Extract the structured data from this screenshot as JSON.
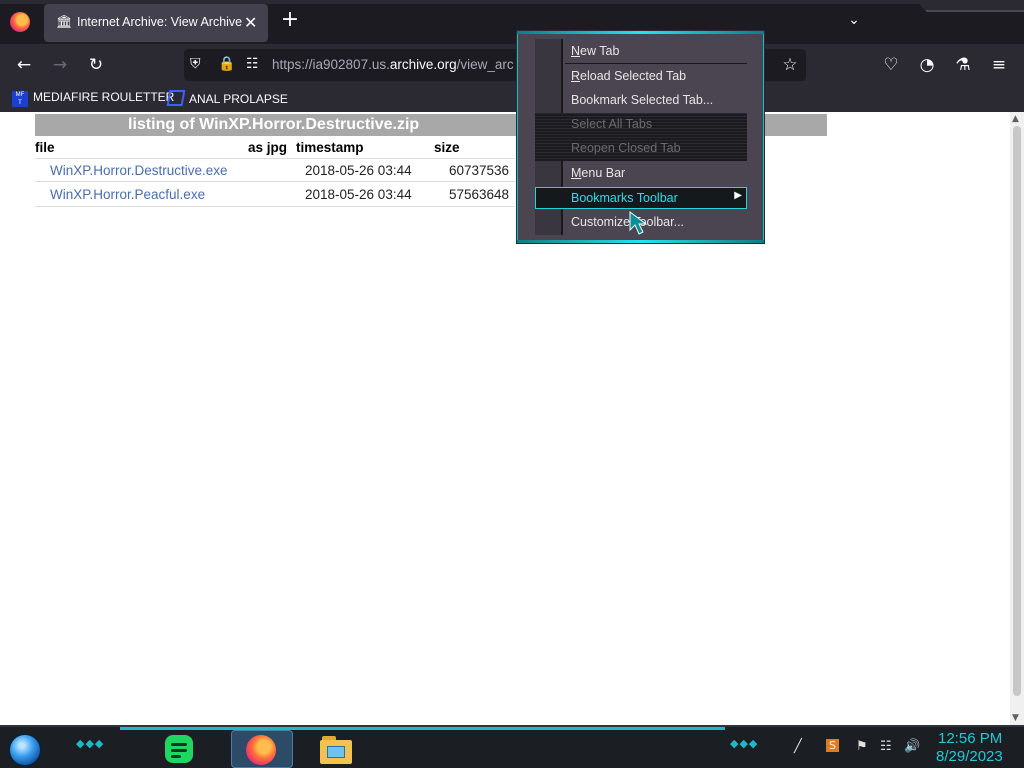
{
  "browser": {
    "tab": {
      "title": "Internet Archive: View Archive",
      "icon": "archive-columns-icon"
    },
    "new_tab_symbol": "+",
    "url": {
      "prefix": "https://ia902807.us.",
      "host": "archive.org",
      "path": "/view_arc"
    },
    "bookmarks": [
      {
        "label": "MEDIAFIRE ROULETTER",
        "icon": "mediafire-icon"
      },
      {
        "label": "ANAL PROLAPSE",
        "icon": "sigma-icon"
      }
    ]
  },
  "page": {
    "title": "listing of WinXP.Horror.Destructive.zip",
    "columns": [
      "file",
      "as jpg",
      "timestamp",
      "size"
    ],
    "rows": [
      {
        "file": "WinXP.Horror.Destructive.exe",
        "timestamp": "2018-05-26 03:44",
        "size": "60737536"
      },
      {
        "file": "WinXP.Horror.Peacful.exe",
        "timestamp": "2018-05-26 03:44",
        "size": "57563648"
      }
    ]
  },
  "context_menu": {
    "items": [
      {
        "key": "N",
        "rest": "ew Tab",
        "pre": "",
        "disabled": false
      },
      {
        "key": "R",
        "rest": "eload Selected Tab",
        "pre": "",
        "disabled": false
      },
      {
        "key": "",
        "rest": "Bookmark Selected Tab...",
        "pre": "",
        "disabled": false
      },
      {
        "key": "",
        "rest": "Select All Tabs",
        "pre": "",
        "disabled": true
      },
      {
        "key": "",
        "rest": "Reopen Closed Tab",
        "pre": "",
        "disabled": true
      },
      {
        "key": "M",
        "rest": "enu Bar",
        "pre": "",
        "disabled": false
      },
      {
        "key": "",
        "rest": "Bookmarks Toolbar",
        "pre": "",
        "disabled": false,
        "highlighted": true,
        "submenu": true
      },
      {
        "key": "",
        "rest": "Customize Toolbar...",
        "pre": "",
        "disabled": false
      }
    ]
  },
  "taskbar": {
    "clock_time": "12:56 PM",
    "clock_date": "8/29/2023"
  },
  "colors": {
    "accent": "#1fb9c6",
    "link": "#4a6cb3",
    "listing_header": "#a8a8a8"
  }
}
